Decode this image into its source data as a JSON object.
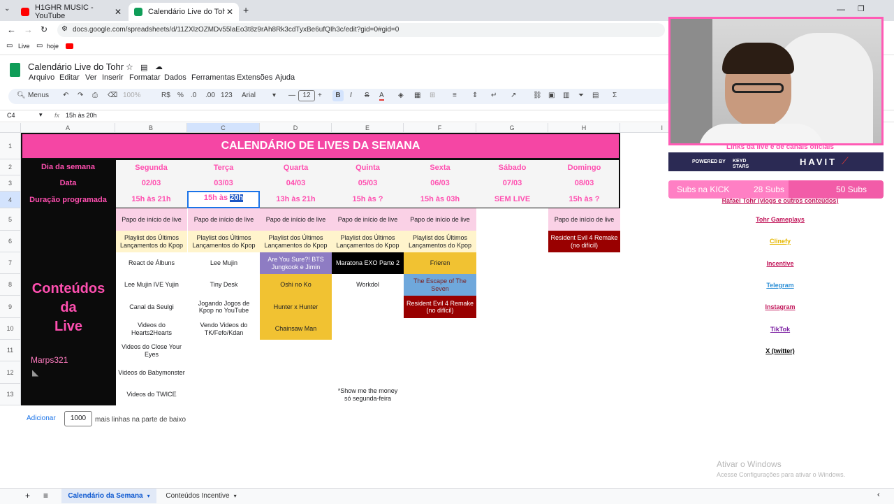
{
  "browser": {
    "tabs": [
      {
        "title": "H1GHR MUSIC - YouTube",
        "active": false
      },
      {
        "title": "Calendário Live do Tohr - Goog",
        "active": true
      }
    ],
    "url": "docs.google.com/spreadsheets/d/11ZXlzOZMDv55laEo3t8z9rAh8Rk3cdTyxBe6ufQIh3c/edit?gid=0#gid=0",
    "bookmarks": [
      "Live",
      "hoje"
    ]
  },
  "doc": {
    "title": "Calendário Live do Tohr",
    "menus": [
      "Arquivo",
      "Editar",
      "Ver",
      "Inserir",
      "Formatar",
      "Dados",
      "Ferramentas",
      "Extensões",
      "Ajuda"
    ]
  },
  "toolbar": {
    "menus_label": "Menus",
    "zoom": "100%",
    "currency": "R$",
    "percent": "%",
    "dec_less": ".0",
    "dec_more": ".00",
    "number_format": "123",
    "font": "Arial",
    "font_size": "12"
  },
  "formula_bar": {
    "cell_ref": "C4",
    "fx": "fx",
    "content": "15h às 20h"
  },
  "columns": [
    "A",
    "B",
    "C",
    "D",
    "E",
    "F",
    "G",
    "H",
    "I"
  ],
  "rows": [
    "1",
    "2",
    "3",
    "4",
    "5",
    "6",
    "7",
    "8",
    "9",
    "10",
    "11",
    "12",
    "13"
  ],
  "sheet": {
    "title": "CALENDÁRIO DE LIVES DA SEMANA",
    "label_day": "Dia da semana",
    "label_date": "Data",
    "label_duration": "Duração programada",
    "days": [
      "Segunda",
      "Terça",
      "Quarta",
      "Quinta",
      "Sexta",
      "Sábado",
      "Domingo"
    ],
    "dates": [
      "02/03",
      "03/03",
      "04/03",
      "05/03",
      "06/03",
      "07/03",
      "08/03"
    ],
    "durations": [
      "15h às 21h",
      "15h às ",
      "13h às 21h",
      "15h às ?",
      "15h às 03h",
      "SEM LIVE",
      "15h às ?"
    ],
    "duration_selected": "20h",
    "contents_title_line1": "Conteúdos",
    "contents_title_line2": "da",
    "contents_title_line3": "Live",
    "watermark": "Marps321",
    "col_b": [
      "Papo de início de live",
      "Playlist dos Últimos Lançamentos do Kpop",
      "React de Álbuns",
      "Lee Mujin IVE Yujin",
      "Canal da Seulgi",
      "Videos do Hearts2Hearts",
      "Videos do Close Your Eyes",
      "Videos do Babymonster",
      "Videos do TWICE"
    ],
    "col_c": [
      "Papo de início de live",
      "Playlist dos Últimos Lançamentos do Kpop",
      "Lee Mujin",
      "Tiny Desk",
      "Jogando Jogos de Kpop no YouTube",
      "Vendo Videos do TK/Fefo/Kdan"
    ],
    "col_d": [
      "Papo de início de live",
      "Playlist dos Últimos Lançamentos do Kpop",
      "Are You Sure?! BTS Jungkook e Jimin",
      "Oshi no Ko",
      "Hunter x Hunter",
      "Chainsaw Man"
    ],
    "col_e": [
      "Papo de início de live",
      "Playlist dos Últimos Lançamentos do Kpop",
      "Maratona EXO Parte 2",
      "Workdol"
    ],
    "col_e_note": "*Show me the money só segunda-feira",
    "col_f": [
      "Papo de início de live",
      "Playlist dos Últimos Lançamentos do Kpop",
      "Frieren",
      "The Escape of The Seven",
      "Resident Evil 4 Remake (no difícil)"
    ],
    "col_h": [
      "Papo de início de live",
      "Resident Evil 4 Remake (no difícil)"
    ],
    "links_header": "Links da live e de canais oficiais",
    "links": [
      {
        "label": "Rafael Tohr (vlogs e outros conteúdos)",
        "color": "#c2185b"
      },
      {
        "label": "Tohr Gameplays",
        "color": "#c2185b"
      },
      {
        "label": "Clinefy",
        "color": "#e6b800"
      },
      {
        "label": "Incentive",
        "color": "#c2185b"
      },
      {
        "label": "Telegram",
        "color": "#2d8fd6"
      },
      {
        "label": "Instagram",
        "color": "#c2185b"
      },
      {
        "label": "TikTok",
        "color": "#7b1fa2"
      },
      {
        "label": "X (twitter)",
        "color": "#000000"
      }
    ]
  },
  "add_rows": {
    "button": "Adicionar",
    "count": "1000",
    "suffix": "mais linhas na parte de baixo"
  },
  "overlay": {
    "sponsor_left": "POWERED BY",
    "sponsor_brand1": "KEYD STARS",
    "sponsor_brand2": "HAVIT",
    "subs_label": "Subs na KICK",
    "subs_current": "28 Subs",
    "subs_goal": "50 Subs"
  },
  "windows_watermark": {
    "title": "Ativar o Windows",
    "subtitle": "Acesse Configurações para ativar o Windows."
  },
  "sheet_tabs": [
    "Calendário da Semana",
    "Conteúdos Incentive"
  ],
  "colors": {
    "pink": "#f546a4",
    "accent_pink": "#ff4fb0",
    "dark": "#0b0b0b"
  }
}
